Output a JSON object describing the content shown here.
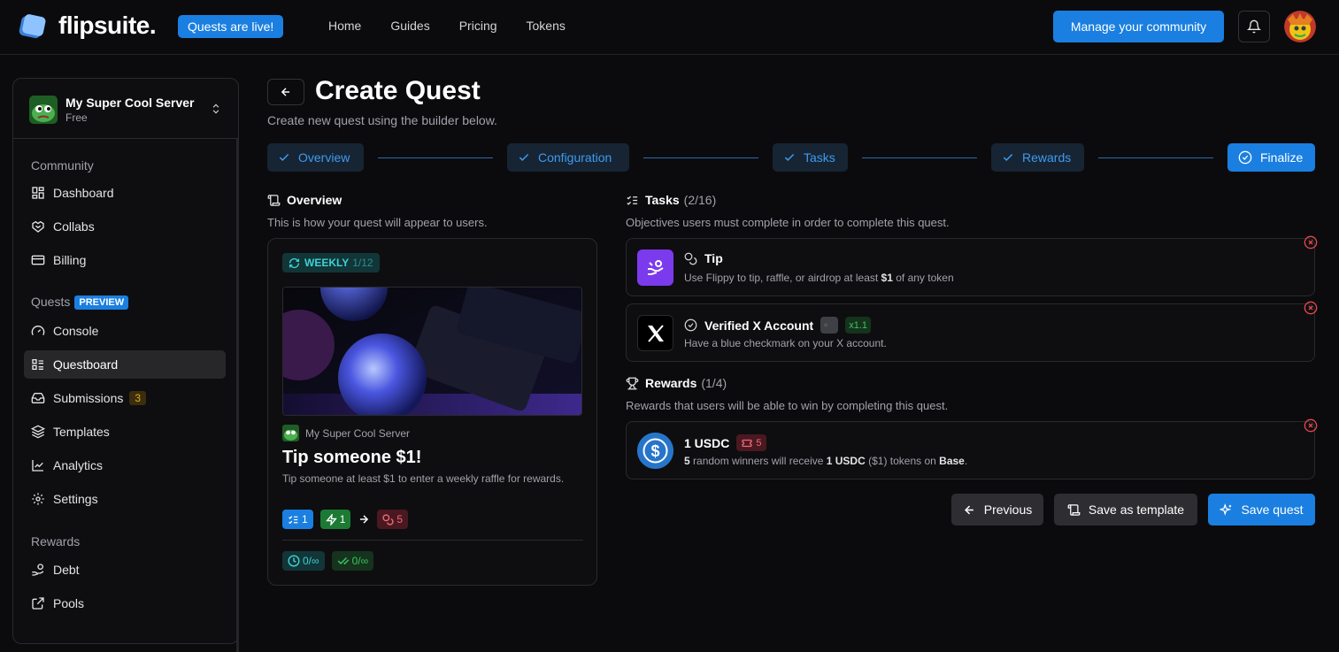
{
  "app": {
    "name": "flipsuite.",
    "live_badge": "Quests are live!",
    "nav": [
      "Home",
      "Guides",
      "Pricing",
      "Tokens"
    ],
    "manage_button": "Manage your community"
  },
  "sidebar": {
    "server_name": "My Super Cool Server",
    "server_plan": "Free",
    "sections": {
      "community": "Community",
      "quests": "Quests",
      "quests_badge": "PREVIEW",
      "rewards": "Rewards"
    },
    "community_items": [
      "Dashboard",
      "Collabs",
      "Billing"
    ],
    "quest_items": [
      "Console",
      "Questboard",
      "Submissions",
      "Templates",
      "Analytics",
      "Settings"
    ],
    "submissions_count": "3",
    "reward_items": [
      "Debt",
      "Pools"
    ],
    "active_item": "Questboard"
  },
  "page": {
    "title": "Create Quest",
    "subtitle": "Create new quest using the builder below."
  },
  "steps": [
    "Overview",
    "Configuration",
    "Tasks",
    "Rewards",
    "Finalize"
  ],
  "overview": {
    "heading": "Overview",
    "subtitle": "This is how your quest will appear to users.",
    "frequency": "WEEKLY",
    "frequency_count": "1/12",
    "server_name": "My Super Cool Server",
    "quest_title": "Tip someone $1!",
    "quest_desc": "Tip someone at least $1 to enter a weekly raffle for rewards.",
    "tasks_count": "1",
    "xp_count": "1",
    "reward_count": "5",
    "time_stat": "0/∞",
    "completed_stat": "0/∞"
  },
  "tasks": {
    "heading": "Tasks",
    "count": "(2/16)",
    "subtitle": "Objectives users must complete in order to complete this quest.",
    "items": [
      {
        "title": "Tip",
        "desc_pre": "Use Flippy to tip, raffle, or airdrop at least ",
        "desc_bold": "$1",
        "desc_post": " of any token"
      },
      {
        "title": "Verified X Account",
        "multiplier": "x1.1",
        "desc": "Have a blue checkmark on your X account."
      }
    ]
  },
  "rewards": {
    "heading": "Rewards",
    "count": "(1/4)",
    "subtitle": "Rewards that users will be able to win by completing this quest.",
    "item": {
      "title": "1 USDC",
      "tickets": "5",
      "winners": "5",
      "desc_mid": " random winners will receive ",
      "amount": "1 USDC",
      "desc_usd": " ($1) tokens on ",
      "chain": "Base",
      "period": "."
    }
  },
  "actions": {
    "previous": "Previous",
    "save_template": "Save as template",
    "save_quest": "Save quest"
  },
  "colors": {
    "accent": "#1a7fe0",
    "background": "#0b0b0d",
    "step_bg": "#172433",
    "danger": "#e5484d"
  }
}
